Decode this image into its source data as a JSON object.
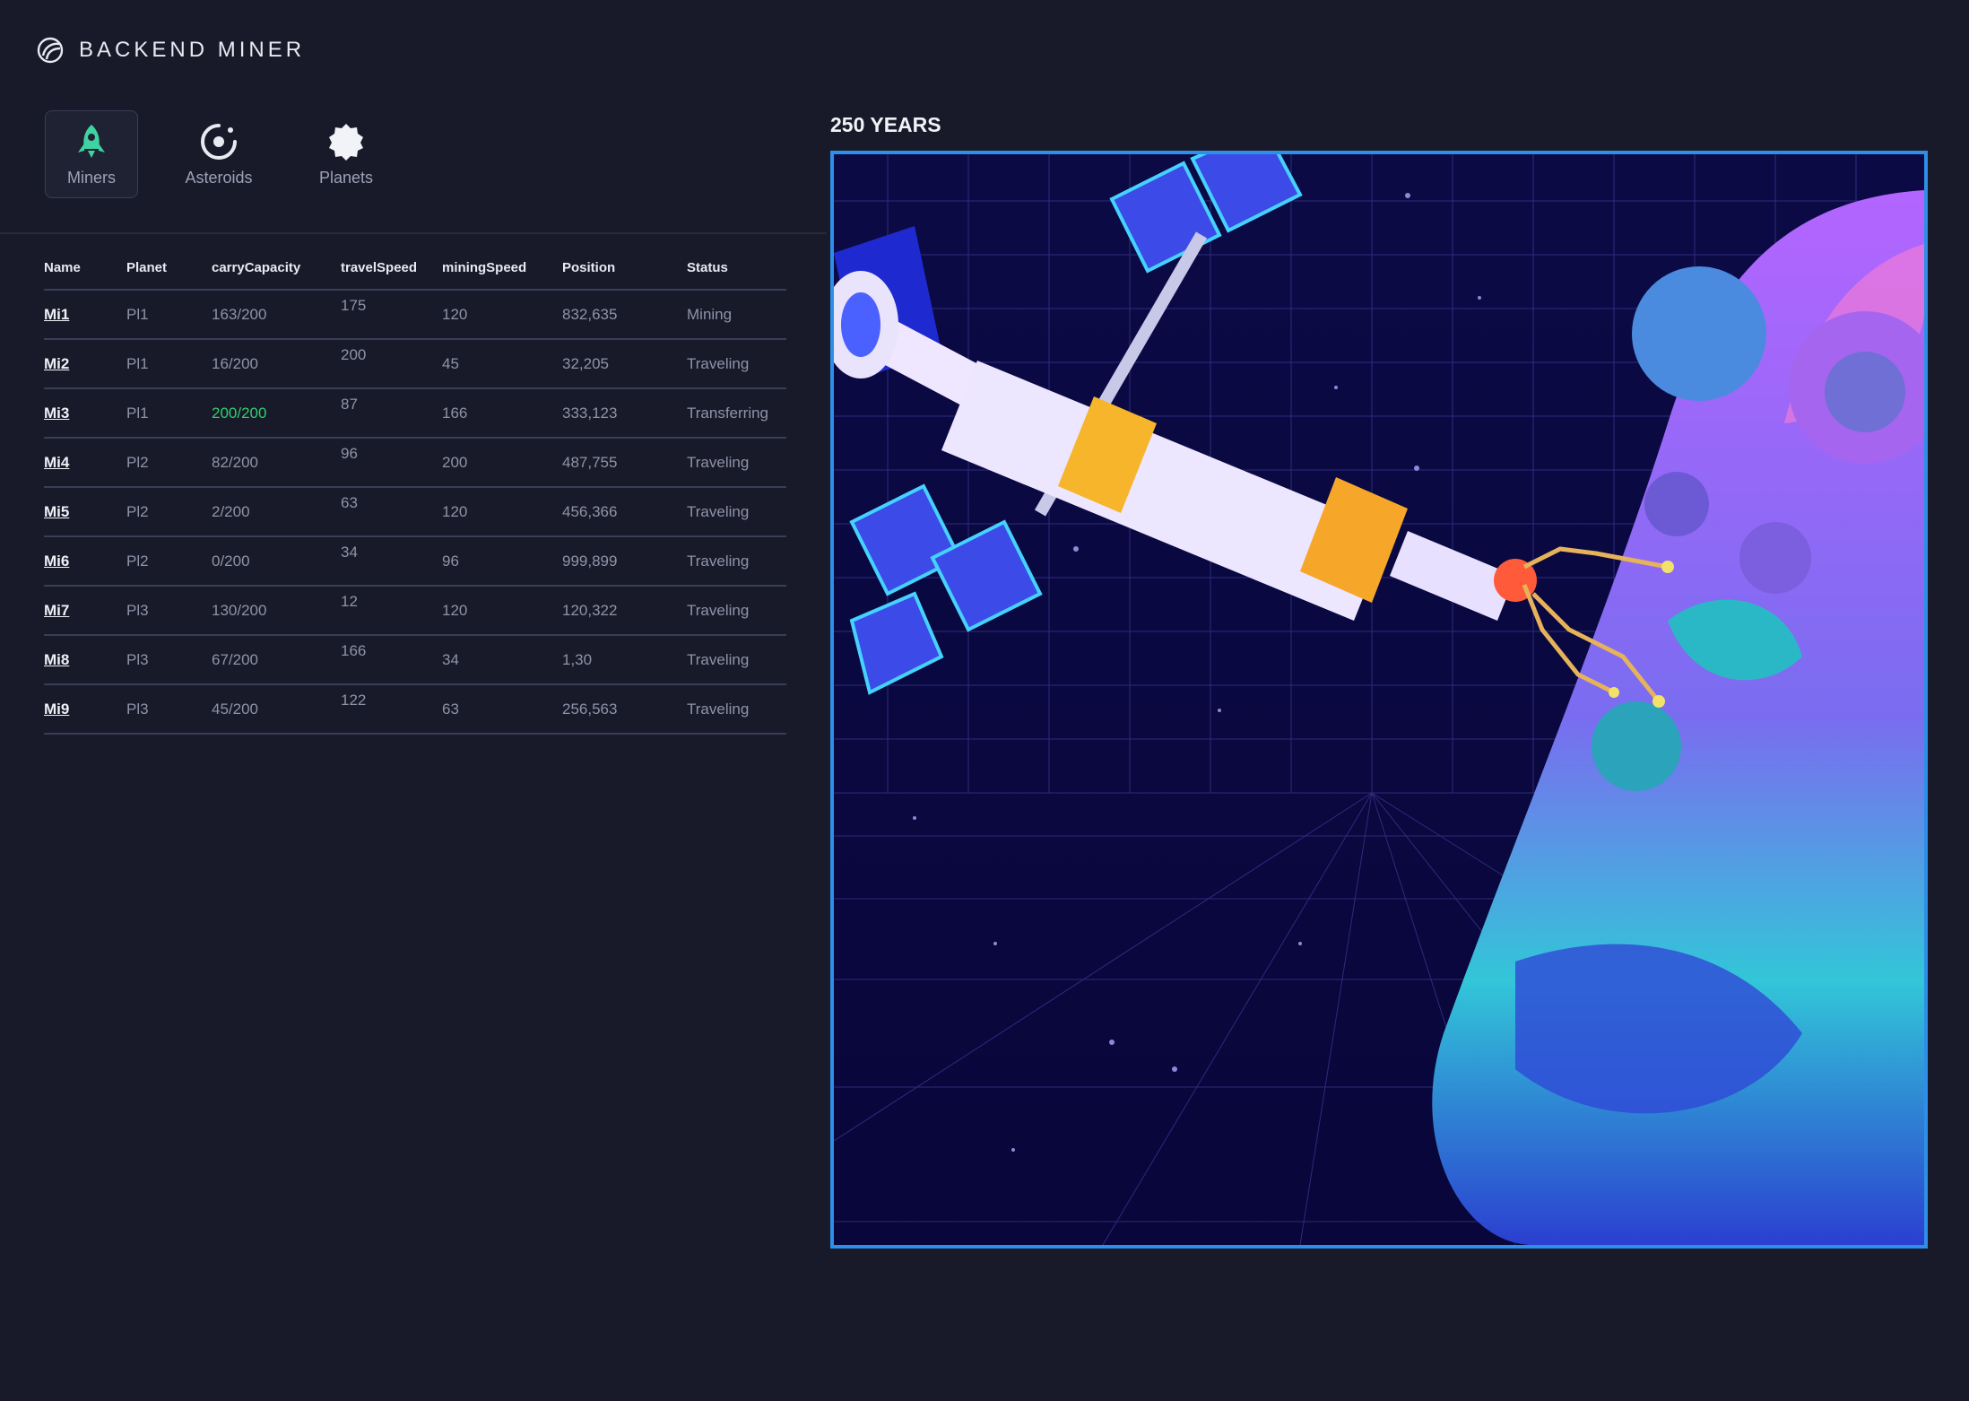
{
  "app": {
    "title": "BACKEND MINER"
  },
  "nav": {
    "tabs": [
      {
        "label": "Miners",
        "icon": "rocket-icon",
        "active": true
      },
      {
        "label": "Asteroids",
        "icon": "asteroid-icon",
        "active": false
      },
      {
        "label": "Planets",
        "icon": "planet-icon",
        "active": false
      }
    ]
  },
  "table": {
    "headers": [
      "Name",
      "Planet",
      "carryCapacity",
      "travelSpeed",
      "miningSpeed",
      "Position",
      "Status"
    ],
    "rows": [
      {
        "name": "Mi1",
        "planet": "Pl1",
        "carry": "163/200",
        "travel": "175",
        "mining": "120",
        "position": "832,635",
        "status": "Mining",
        "carry_full": false
      },
      {
        "name": "Mi2",
        "planet": "Pl1",
        "carry": "16/200",
        "travel": "200",
        "mining": "45",
        "position": "32,205",
        "status": "Traveling",
        "carry_full": false
      },
      {
        "name": "Mi3",
        "planet": "Pl1",
        "carry": "200/200",
        "travel": "87",
        "mining": "166",
        "position": "333,123",
        "status": "Transferring",
        "carry_full": true
      },
      {
        "name": "Mi4",
        "planet": "Pl2",
        "carry": "82/200",
        "travel": "96",
        "mining": "200",
        "position": "487,755",
        "status": "Traveling",
        "carry_full": false
      },
      {
        "name": "Mi5",
        "planet": "Pl2",
        "carry": "2/200",
        "travel": "63",
        "mining": "120",
        "position": "456,366",
        "status": "Traveling",
        "carry_full": false
      },
      {
        "name": "Mi6",
        "planet": "Pl2",
        "carry": "0/200",
        "travel": "34",
        "mining": "96",
        "position": "999,899",
        "status": "Traveling",
        "carry_full": false
      },
      {
        "name": "Mi7",
        "planet": "Pl3",
        "carry": "130/200",
        "travel": "12",
        "mining": "120",
        "position": "120,322",
        "status": "Traveling",
        "carry_full": false
      },
      {
        "name": "Mi8",
        "planet": "Pl3",
        "carry": "67/200",
        "travel": "166",
        "mining": "34",
        "position": "1,30",
        "status": "Traveling",
        "carry_full": false
      },
      {
        "name": "Mi9",
        "planet": "Pl3",
        "carry": "45/200",
        "travel": "122",
        "mining": "63",
        "position": "256,563",
        "status": "Traveling",
        "carry_full": false
      }
    ]
  },
  "scene": {
    "title": "250 YEARS"
  },
  "colors": {
    "background": "#181a29",
    "accent_active": "#3ed3a1",
    "full_capacity": "#2fcf6d",
    "viewport_border": "#2d8fe8"
  }
}
